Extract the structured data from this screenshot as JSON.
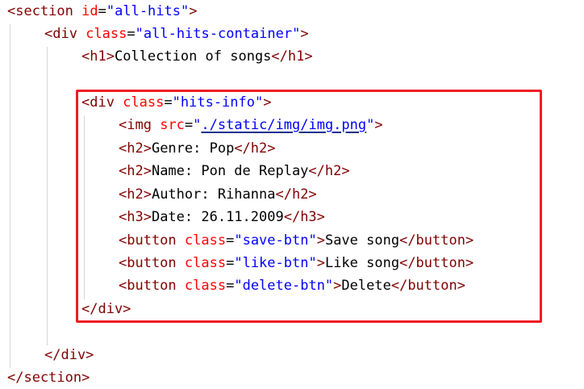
{
  "code": {
    "l1": {
      "open": "<section",
      "attr": "id",
      "eq": "=",
      "val": "\"all-hits\"",
      "close": ">"
    },
    "l2": {
      "open": "<div",
      "attr": "class",
      "eq": "=",
      "val": "\"all-hits-container\"",
      "close": ">"
    },
    "l3": {
      "open": "<h1>",
      "text": "Collection of songs",
      "close": "</h1>"
    },
    "l5": {
      "open": "<div",
      "attr": "class",
      "eq": "=",
      "val": "\"hits-info\"",
      "close": ">"
    },
    "l6": {
      "open": "<img",
      "attr": "src",
      "eq": "=",
      "q1": "\"",
      "link": "./static/img/img.png",
      "q2": "\"",
      "close": ">"
    },
    "l7": {
      "open": "<h2>",
      "text": "Genre: Pop",
      "close": "</h2>"
    },
    "l8": {
      "open": "<h2>",
      "text": "Name: Pon de Replay",
      "close": "</h2>"
    },
    "l9": {
      "open": "<h2>",
      "text": "Author: Rihanna",
      "close": "</h2>"
    },
    "l10": {
      "open": "<h3>",
      "text": "Date: 26.11.2009",
      "close": "</h3>"
    },
    "l11": {
      "open": "<button",
      "attr": "class",
      "eq": "=",
      "val": "\"save-btn\"",
      "gt": ">",
      "text": "Save song",
      "close": "</button>"
    },
    "l12": {
      "open": "<button",
      "attr": "class",
      "eq": "=",
      "val": "\"like-btn\"",
      "gt": ">",
      "text": "Like song",
      "close": "</button>"
    },
    "l13": {
      "open": "<button",
      "attr": "class",
      "eq": "=",
      "val": "\"delete-btn\"",
      "gt": ">",
      "text": "Delete",
      "close": "</button>"
    },
    "l14": {
      "close": "</div>"
    },
    "l16": {
      "close": "</div>"
    },
    "l17": {
      "close": "</section>"
    }
  },
  "colors": {
    "tag": "#800000",
    "attribute": "#ff0000",
    "value": "#0000ff",
    "highlight_border": "#ee1c24"
  }
}
